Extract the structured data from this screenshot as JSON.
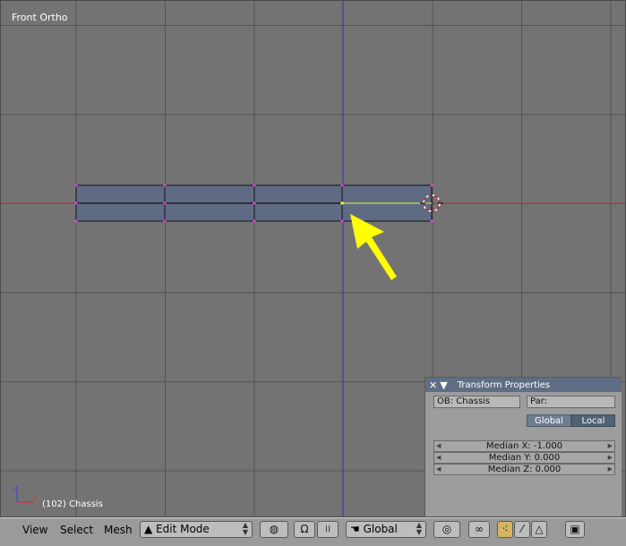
{
  "viewport": {
    "label": "Front Ortho",
    "object_info": "(102) Chassis"
  },
  "transform_panel": {
    "title": "Transform Properties",
    "ob_field": "OB: Chassis",
    "par_field": "Par:",
    "global_label": "Global",
    "local_label": "Local",
    "median_x": "Median X: -1.000",
    "median_y": "Median Y: 0.000",
    "median_z": "Median Z: 0.000"
  },
  "toolbar": {
    "menus": [
      "View",
      "Select",
      "Mesh"
    ],
    "mode": "Edit Mode",
    "orientation": "Global"
  },
  "colors": {
    "mesh_fill": "#5f6a83",
    "vertex": "#e040e0",
    "arrow": "#ffff00",
    "x_axis": "#c04040",
    "z_axis": "#5050c0"
  },
  "icons": {
    "close": "close-icon",
    "collapse": "triangle-down-icon",
    "mode": "edit-mode-icon",
    "draw_type": "sphere-wire-icon",
    "magnet": "magnet-icon",
    "snap": "snap-grid-icon",
    "orientation": "hand-icon",
    "pivot": "pivot-icon",
    "link": "link-icon",
    "vertex": "vertex-select-icon",
    "edge": "edge-select-icon",
    "face": "face-select-icon",
    "render": "render-icon"
  }
}
